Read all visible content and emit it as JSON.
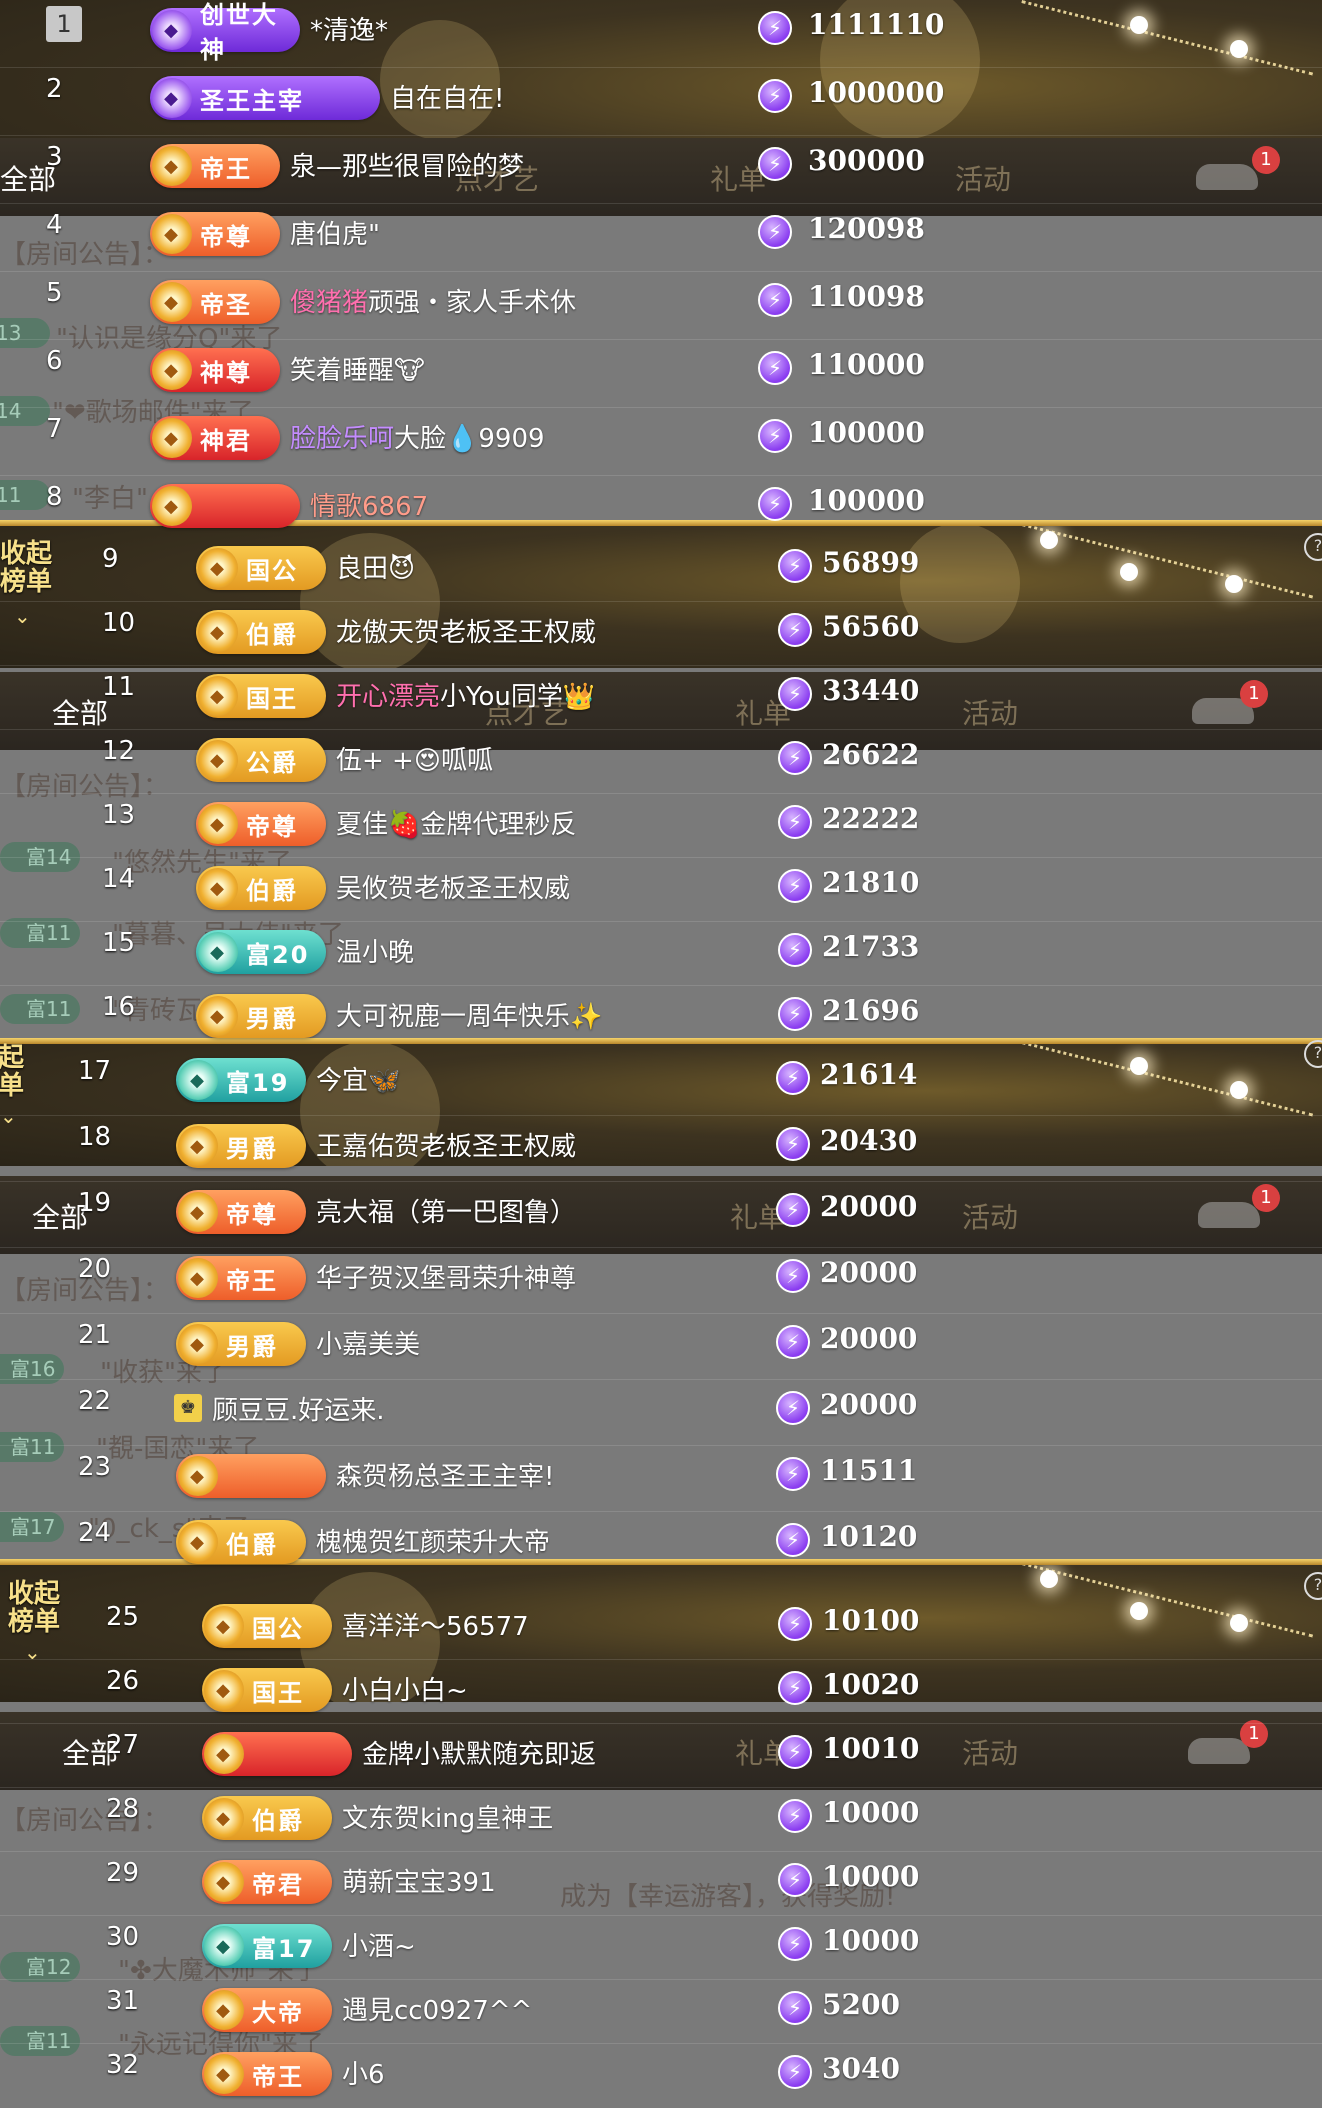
{
  "panels": [
    {
      "rows": [
        {
          "rank": "1",
          "badge": "创世大神",
          "badge_style": "purple",
          "name": "*清逸*",
          "score": "1111110"
        },
        {
          "rank": "2",
          "badge": "圣王主宰",
          "badge_style": "purple",
          "name": "自在自在!",
          "score": "1000000"
        },
        {
          "rank": "3",
          "badge": "帝王",
          "badge_style": "orange",
          "name": "泉—那些很冒险的梦",
          "score": "300000"
        },
        {
          "rank": "4",
          "badge": "帝尊",
          "badge_style": "orange",
          "name": "唐伯虎\"",
          "score": "120098"
        },
        {
          "rank": "5",
          "badge": "帝圣",
          "badge_style": "orange",
          "name_pink": "傻猪猪",
          "name": "顽强・家人手术休",
          "score": "110098"
        },
        {
          "rank": "6",
          "badge": "神尊",
          "badge_style": "red",
          "name": "笑着睡醒🐮",
          "score": "110000"
        },
        {
          "rank": "7",
          "badge": "神君",
          "badge_style": "red",
          "name_violet": "脸脸乐呵",
          "name": "大脸💧9909",
          "score": "100000"
        },
        {
          "rank": "8",
          "badge": "",
          "badge_style": "red",
          "name_salmon": "情歌6867",
          "name": "",
          "score": "100000"
        }
      ]
    },
    {
      "rows": [
        {
          "rank": "9",
          "badge": "国公",
          "badge_style": "gold",
          "name": "良田😈",
          "score": "56899"
        },
        {
          "rank": "10",
          "badge": "伯爵",
          "badge_style": "gold",
          "name": "龙傲天贺老板圣王权威",
          "score": "56560"
        },
        {
          "rank": "11",
          "badge": "国王",
          "badge_style": "gold",
          "name_pink": "开心漂亮",
          "name": "小You同学👑",
          "score": "33440"
        },
        {
          "rank": "12",
          "badge": "公爵",
          "badge_style": "gold",
          "name": "伍+ +😍呱呱",
          "score": "26622"
        },
        {
          "rank": "13",
          "badge": "帝尊",
          "badge_style": "orange",
          "name": "夏佳🍓金牌代理秒反",
          "score": "22222"
        },
        {
          "rank": "14",
          "badge": "伯爵",
          "badge_style": "gold",
          "name": "吴攸贺老板圣王权威",
          "score": "21810"
        },
        {
          "rank": "15",
          "badge": "富20",
          "badge_style": "teal",
          "name": "温小晚",
          "score": "21733"
        },
        {
          "rank": "16",
          "badge": "男爵",
          "badge_style": "gold",
          "name": "大可祝鹿一周年快乐✨",
          "score": "21696"
        }
      ]
    },
    {
      "rows": [
        {
          "rank": "17",
          "badge": "富19",
          "badge_style": "teal",
          "name": "今宜🦋",
          "score": "21614"
        },
        {
          "rank": "18",
          "badge": "男爵",
          "badge_style": "gold",
          "name": "王嘉佑贺老板圣王权威",
          "score": "20430"
        },
        {
          "rank": "19",
          "badge": "帝尊",
          "badge_style": "orange",
          "name": "亮大福（第一巴图鲁）",
          "score": "20000"
        },
        {
          "rank": "20",
          "badge": "帝王",
          "badge_style": "orange",
          "name": "华子贺汉堡哥荣升神尊",
          "score": "20000"
        },
        {
          "rank": "21",
          "badge": "男爵",
          "badge_style": "gold",
          "name": "小嘉美美",
          "score": "20000"
        },
        {
          "rank": "22",
          "badge": "",
          "badge_style": "none",
          "name": "顾豆豆.好运来.",
          "score": "20000"
        },
        {
          "rank": "23",
          "badge": "",
          "badge_style": "orange",
          "name": "森贺杨总圣王主宰!",
          "score": "11511"
        },
        {
          "rank": "24",
          "badge": "伯爵",
          "badge_style": "gold",
          "name": "槐槐贺红颜荣升大帝",
          "score": "10120"
        }
      ]
    },
    {
      "rows": [
        {
          "rank": "25",
          "badge": "国公",
          "badge_style": "gold",
          "name": "喜洋洋～56577",
          "score": "10100"
        },
        {
          "rank": "26",
          "badge": "国王",
          "badge_style": "gold",
          "name": "小白小白~",
          "score": "10020"
        },
        {
          "rank": "27",
          "badge": "",
          "badge_style": "red",
          "name": "金牌小默默随充即返",
          "score": "10010"
        },
        {
          "rank": "28",
          "badge": "伯爵",
          "badge_style": "gold",
          "name": "文东贺king皇神王",
          "score": "10000"
        },
        {
          "rank": "29",
          "badge": "帝君",
          "badge_style": "orange",
          "name": "萌新宝宝391",
          "score": "10000"
        },
        {
          "rank": "30",
          "badge": "富17",
          "badge_style": "teal",
          "name": "小酒~",
          "score": "10000"
        },
        {
          "rank": "31",
          "badge": "大帝",
          "badge_style": "orange",
          "name": "遇見cc0927^^",
          "score": "5200"
        },
        {
          "rank": "32",
          "badge": "帝王",
          "badge_style": "orange",
          "name": "小6",
          "score": "3040"
        }
      ]
    }
  ],
  "overlay": {
    "all_tab": "全部",
    "gift_tab": "礼单",
    "activity_tab": "活动",
    "talent_tab": "点才艺",
    "notice": "【房间公告】：",
    "notif_badge": "1",
    "collapse_label": "收起榜单"
  },
  "ghost_texts": {
    "g1": "\"认识是缘分Q\"来了",
    "g2": "\"❤歌场邮件\"来了",
    "g3": "\"李白\"",
    "g4": "\"悠然先生\"来了",
    "g5": "\"暮暮、吴大伟\"来了",
    "g6": "\"青砖瓦\"来了",
    "g7": "\"收获\"来了",
    "g8": "\"覩-国恋\"来了",
    "g9": "\"0_ck_s\"来了",
    "g10": "\"✤大魔术师\"来了",
    "g11": "\"永远记得你\"来了",
    "g12": "成为【幸运游客】，获得奖励!"
  },
  "ghost_pills": {
    "p13": "13",
    "p14": "14",
    "p11": "11",
    "f14": "富14",
    "f11": "富11",
    "f16": "富16",
    "f17": "富17",
    "f12": "富12"
  },
  "icons": {
    "bolt": "lightning-icon",
    "car": "car-icon",
    "help": "help-icon",
    "chevron": "chevron-down-icon"
  },
  "colors": {
    "accent_gold": "#f5d36a",
    "score_icon": "#8a3cf0"
  }
}
